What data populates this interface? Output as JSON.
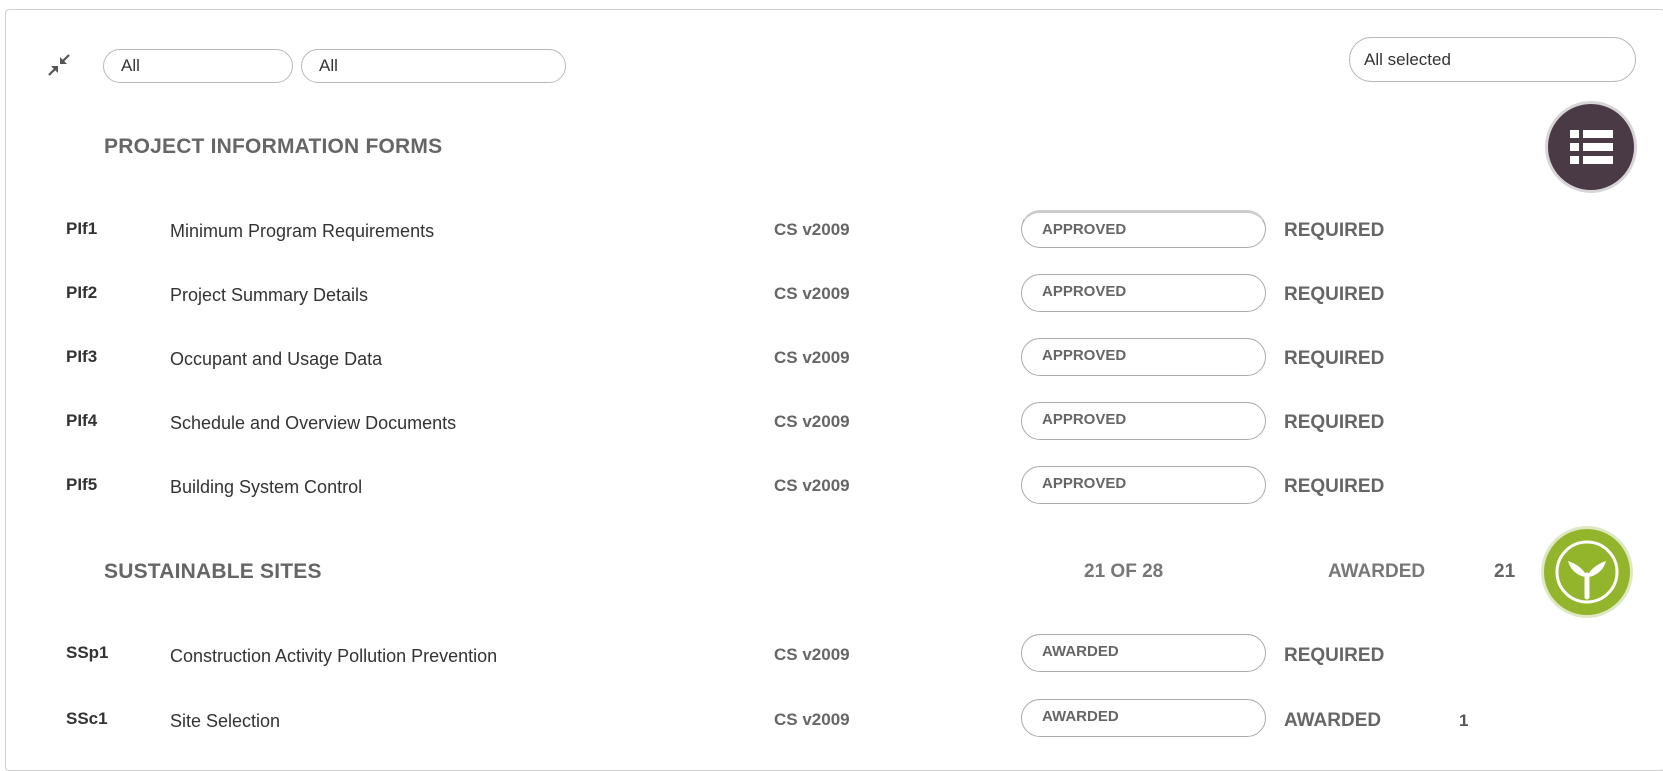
{
  "filters": {
    "filter1_value": "All",
    "filter2_value": "All",
    "right_filter_value": "All selected"
  },
  "sections": {
    "pif": {
      "title": "PROJECT INFORMATION FORMS",
      "rows": [
        {
          "code": "PIf1",
          "name": "Minimum Program Requirements",
          "version": "CS v2009",
          "status": "APPROVED",
          "requirement": "REQUIRED",
          "points": ""
        },
        {
          "code": "PIf2",
          "name": "Project Summary Details",
          "version": "CS v2009",
          "status": "APPROVED",
          "requirement": "REQUIRED",
          "points": ""
        },
        {
          "code": "PIf3",
          "name": "Occupant and Usage Data",
          "version": "CS v2009",
          "status": "APPROVED",
          "requirement": "REQUIRED",
          "points": ""
        },
        {
          "code": "PIf4",
          "name": "Schedule and Overview Documents",
          "version": "CS v2009",
          "status": "APPROVED",
          "requirement": "REQUIRED",
          "points": ""
        },
        {
          "code": "PIf5",
          "name": "Building System Control",
          "version": "CS v2009",
          "status": "APPROVED",
          "requirement": "REQUIRED",
          "points": ""
        }
      ]
    },
    "ss": {
      "title": "SUSTAINABLE SITES",
      "progress": "21 OF 28",
      "awarded_label": "AWARDED",
      "awarded_points": "21",
      "rows": [
        {
          "code": "SSp1",
          "name": "Construction Activity Pollution Prevention",
          "version": "CS v2009",
          "status": "AWARDED",
          "requirement": "REQUIRED",
          "points": ""
        },
        {
          "code": "SSc1",
          "name": "Site Selection",
          "version": "CS v2009",
          "status": "AWARDED",
          "requirement": "AWARDED",
          "points": "1"
        }
      ]
    }
  },
  "icons": {
    "collapse": "compress-arrows-icon",
    "pif_badge": "list-icon",
    "ss_badge": "sprout-icon"
  },
  "colors": {
    "pif_badge": "#4a3a46",
    "ss_badge": "#93b52c",
    "text_gray": "#666666"
  }
}
